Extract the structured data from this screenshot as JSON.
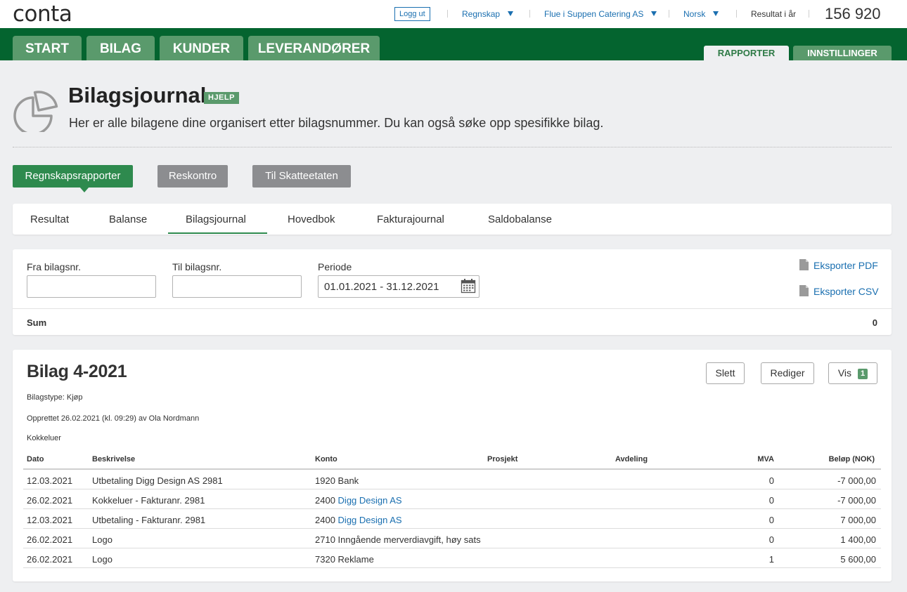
{
  "topbar": {
    "logo": "conta",
    "logout": "Logg ut",
    "regnskap": "Regnskap",
    "company": "Flue i Suppen Catering AS",
    "language": "Norsk",
    "result_label": "Resultat i år",
    "result_value": "156 920"
  },
  "nav": {
    "tabs": [
      "START",
      "BILAG",
      "KUNDER",
      "LEVERANDØRER"
    ],
    "right_tabs": [
      "RAPPORTER",
      "INNSTILLINGER"
    ]
  },
  "header": {
    "title": "Bilagsjournal",
    "help": "HJELP",
    "subtitle": "Her er alle bilagene dine organisert etter bilagsnummer. Du kan også søke opp spesifikke bilag."
  },
  "report_buttons": [
    "Regnskapsrapporter",
    "Reskontro",
    "Til Skatteetaten"
  ],
  "subtabs": [
    "Resultat",
    "Balanse",
    "Bilagsjournal",
    "Hovedbok",
    "Fakturajournal",
    "Saldobalanse"
  ],
  "filter": {
    "from_label": "Fra bilagsnr.",
    "from_value": "",
    "to_label": "Til bilagsnr.",
    "to_value": "",
    "period_label": "Periode",
    "period_value": "01.01.2021 - 31.12.2021",
    "export_pdf": "Eksporter PDF",
    "export_csv": "Eksporter CSV",
    "sum_label": "Sum",
    "sum_value": "0"
  },
  "bilag": {
    "title": "Bilag 4-2021",
    "type": "Bilagstype: Kjøp",
    "created": "Opprettet 26.02.2021 (kl. 09:29) av Ola Nordmann",
    "description": "Kokkeluer",
    "buttons": {
      "delete": "Slett",
      "edit": "Rediger",
      "view": "Vis",
      "view_count": "1"
    },
    "columns": [
      "Dato",
      "Beskrivelse",
      "Konto",
      "Prosjekt",
      "Avdeling",
      "MVA",
      "Beløp (NOK)"
    ],
    "rows": [
      {
        "date": "12.03.2021",
        "desc": "Utbetaling Digg Design AS 2981",
        "konto_num": "1920",
        "konto_name": "Bank",
        "konto_link": false,
        "mva": "0",
        "amount": "-7 000,00"
      },
      {
        "date": "26.02.2021",
        "desc": "Kokkeluer - Fakturanr. 2981",
        "konto_num": "2400",
        "konto_name": "Digg Design AS",
        "konto_link": true,
        "mva": "0",
        "amount": "-7 000,00"
      },
      {
        "date": "12.03.2021",
        "desc": "Utbetaling - Fakturanr. 2981",
        "konto_num": "2400",
        "konto_name": "Digg Design AS",
        "konto_link": true,
        "mva": "0",
        "amount": "7 000,00"
      },
      {
        "date": "26.02.2021",
        "desc": "Logo",
        "konto_num": "2710",
        "konto_name": "Inngående merverdiavgift, høy sats",
        "konto_link": false,
        "mva": "0",
        "amount": "1 400,00"
      },
      {
        "date": "26.02.2021",
        "desc": "Logo",
        "konto_num": "7320",
        "konto_name": "Reklame",
        "konto_link": false,
        "mva": "1",
        "amount": "5 600,00"
      }
    ]
  }
}
